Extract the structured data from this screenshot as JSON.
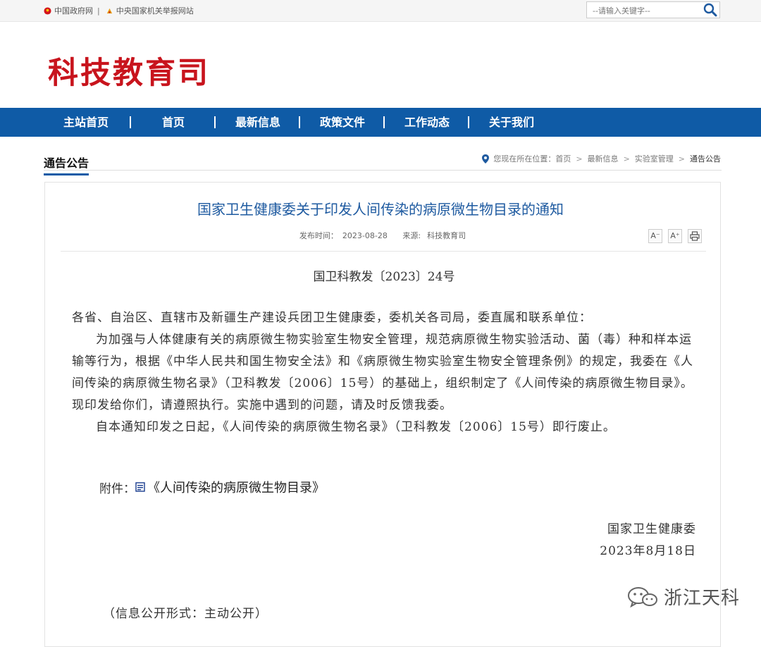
{
  "topbar": {
    "links": [
      "中国政府网",
      "中央国家机关举报网站"
    ],
    "separator": "|",
    "search_placeholder": "--请输入关键字--"
  },
  "header": {
    "logo": "科技教育司"
  },
  "nav": {
    "items": [
      "主站首页",
      "首页",
      "最新信息",
      "政策文件",
      "工作动态",
      "关于我们"
    ],
    "separator": "|"
  },
  "section": {
    "title": "通告公告"
  },
  "breadcrumb": {
    "prefix": "您现在所在位置：",
    "items": [
      "首页",
      "最新信息",
      "实验室管理",
      "通告公告"
    ],
    "separator": ">"
  },
  "article": {
    "title": "国家卫生健康委关于印发人间传染的病原微生物目录的通知",
    "meta": {
      "date_label": "发布时间：",
      "date": "2023-08-28",
      "source_label": "来源:",
      "source": "科技教育司"
    },
    "tools": {
      "font_smaller": "A⁻",
      "font_larger": "A⁺"
    },
    "doc_number": "国卫科教发〔2023〕24号",
    "salutation": "各省、自治区、直辖市及新疆生产建设兵团卫生健康委，委机关各司局，委直属和联系单位：",
    "para1": "为加强与人体健康有关的病原微生物实验室生物安全管理，规范病原微生物实验活动、菌（毒）种和样本运输等行为，根据《中华人民共和国生物安全法》和《病原微生物实验室生物安全管理条例》的规定，我委在《人间传染的病原微生物名录》（卫科教发〔2006〕15号）的基础上，组织制定了《人间传染的病原微生物目录》。现印发给你们，请遵照执行。实施中遇到的问题，请及时反馈我委。",
    "para2": "自本通知印发之日起，《人间传染的病原微生物名录》（卫科教发〔2006〕15号）即行废止。",
    "attachment_label": "附件：",
    "attachment_name": "《人间传染的病原微生物目录》",
    "signature": "国家卫生健康委",
    "sign_date": "2023年8月18日",
    "disclosure": "（信息公开形式：主动公开）"
  },
  "watermark": {
    "text": "浙江天科"
  },
  "colors": {
    "brand_red": "#c8141d",
    "nav_blue": "#0f5ba6",
    "title_blue": "#1e5aa0"
  }
}
